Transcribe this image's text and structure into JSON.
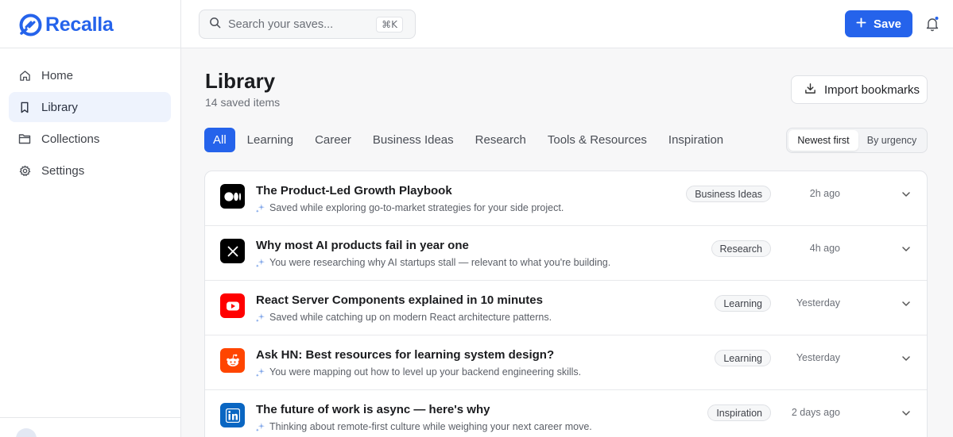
{
  "brand": {
    "name": "Recalla",
    "accent": "#2563eb"
  },
  "sidebar": {
    "items": [
      {
        "label": "Home",
        "icon": "home-icon",
        "active": false
      },
      {
        "label": "Library",
        "icon": "bookmark-icon",
        "active": true
      },
      {
        "label": "Collections",
        "icon": "folder-icon",
        "active": false
      },
      {
        "label": "Settings",
        "icon": "gear-icon",
        "active": false
      }
    ]
  },
  "topbar": {
    "search_placeholder": "Search your saves...",
    "search_shortcut": "⌘K",
    "save_label": "Save"
  },
  "page": {
    "title": "Library",
    "subtitle": "14 saved items",
    "import_label": "Import bookmarks"
  },
  "tabs": [
    {
      "label": "All",
      "active": true
    },
    {
      "label": "Learning",
      "active": false
    },
    {
      "label": "Career",
      "active": false
    },
    {
      "label": "Business Ideas",
      "active": false
    },
    {
      "label": "Research",
      "active": false
    },
    {
      "label": "Tools & Resources",
      "active": false
    },
    {
      "label": "Inspiration",
      "active": false
    }
  ],
  "sort": {
    "options": [
      "Newest first",
      "By urgency"
    ],
    "selected": "Newest first"
  },
  "items": [
    {
      "source": "medium",
      "source_color": "#000000",
      "title": "The Product-Led Growth Playbook",
      "note": "Saved while exploring go-to-market strategies for your side project.",
      "tag": "Business Ideas",
      "time": "2h ago"
    },
    {
      "source": "x",
      "source_color": "#000000",
      "title": "Why most AI products fail in year one",
      "note": "You were researching why AI startups stall — relevant to what you're building.",
      "tag": "Research",
      "time": "4h ago"
    },
    {
      "source": "youtube",
      "source_color": "#ff0000",
      "title": "React Server Components explained in 10 minutes",
      "note": "Saved while catching up on modern React architecture patterns.",
      "tag": "Learning",
      "time": "Yesterday"
    },
    {
      "source": "reddit",
      "source_color": "#ff4500",
      "title": "Ask HN: Best resources for learning system design?",
      "note": "You were mapping out how to level up your backend engineering skills.",
      "tag": "Learning",
      "time": "Yesterday"
    },
    {
      "source": "linkedin",
      "source_color": "#0a66c2",
      "title": "The future of work is async — here's why",
      "note": "Thinking about remote-first culture while weighing your next career move.",
      "tag": "Inspiration",
      "time": "2 days ago"
    }
  ]
}
